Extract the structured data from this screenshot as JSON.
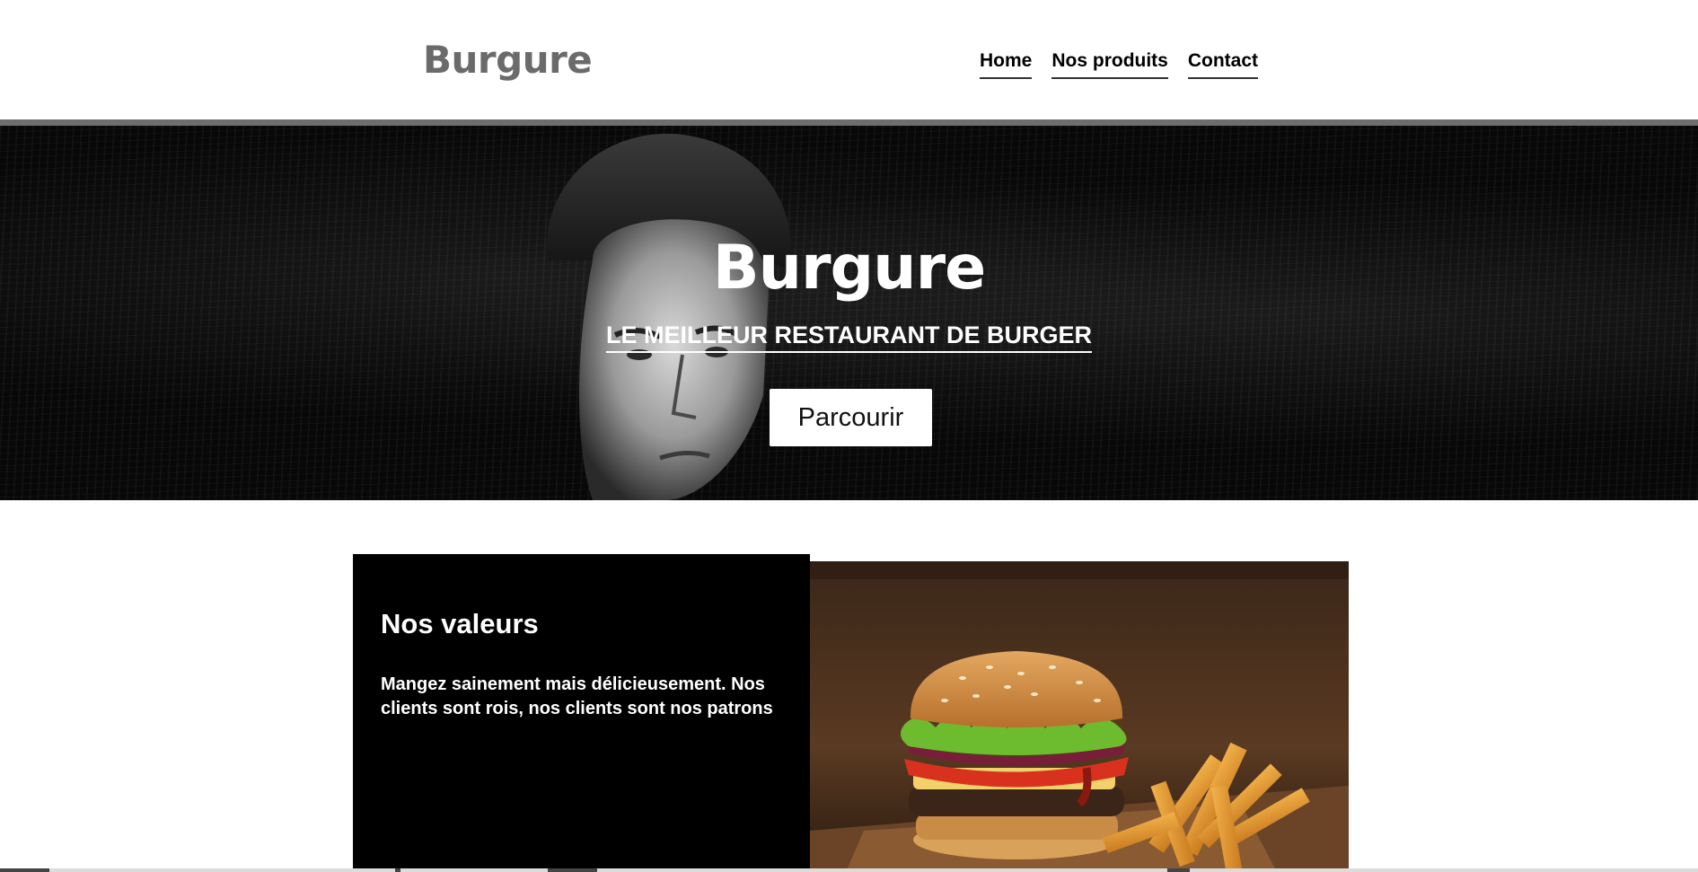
{
  "header": {
    "logo": "Burgure",
    "nav": [
      {
        "label": "Home"
      },
      {
        "label": "Nos produits"
      },
      {
        "label": "Contact"
      }
    ]
  },
  "hero": {
    "title": "Burgure",
    "subtitle": "LE MEILLEUR RESTAURANT DE BURGER",
    "button_label": "Parcourir"
  },
  "values": {
    "title": "Nos valeurs",
    "text": "Mangez sainement mais délicieusement. Nos clients sont rois, nos clients sont nos patrons"
  },
  "colors": {
    "logo": "#6b6b6b",
    "header_rule": "#6e6e6e",
    "hero_bg": "#080808",
    "values_bg": "#000000",
    "text_light": "#ffffff"
  }
}
